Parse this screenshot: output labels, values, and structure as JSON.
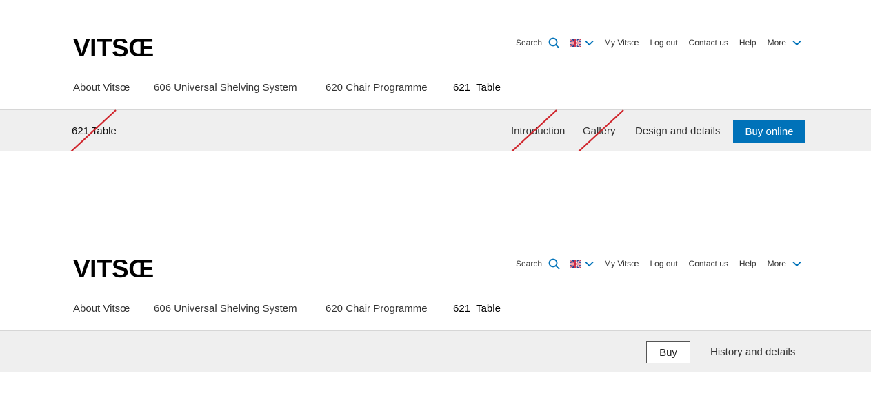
{
  "brand": {
    "logo_text": "VITSŒ"
  },
  "util_nav": {
    "search_label": "Search",
    "search_icon": "search-icon",
    "language_icon": "uk-flag-icon",
    "my_vitsoe": "My Vitsœ",
    "log_out": "Log out",
    "contact_us": "Contact us",
    "help": "Help",
    "more": "More"
  },
  "main_nav": {
    "about": "About Vitsœ",
    "shelving": "606 Universal Shelving System",
    "chair": "620 Chair Programme",
    "table": "621  Table"
  },
  "sub_nav_top": {
    "title": "621 Table",
    "introduction": "Introduction",
    "gallery": "Gallery",
    "design_details": "Design and details",
    "buy_online": "Buy online"
  },
  "sub_nav_bottom": {
    "buy": "Buy",
    "history_details": "History and details"
  },
  "colors": {
    "accent_blue": "#0072b9",
    "strike_red": "#d0262d",
    "subbar_bg": "#efefef"
  }
}
